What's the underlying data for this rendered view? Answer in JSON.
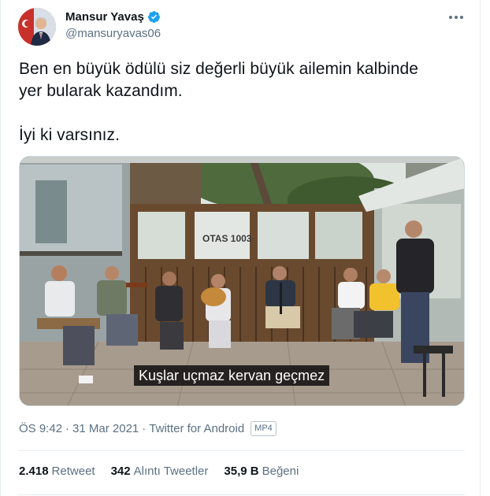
{
  "author": {
    "display_name": "Mansur Yavaş",
    "handle": "@mansuryavas06",
    "verified": true
  },
  "tweet": {
    "text": "Ben en büyük ödülü siz değerli büyük ailemin kalbinde\nyer bularak kazandım.\n\nİyi ki varsınız."
  },
  "media": {
    "caption": "Kuşlar uçmaz kervan geçmez",
    "sign_text": "OTAS 1003"
  },
  "meta": {
    "time": "ÖS 9:42",
    "separator": "·",
    "date": "31 Mar 2021",
    "source": "Twitter for Android",
    "badge": "MP4"
  },
  "stats": {
    "retweets_count": "2.418",
    "retweets_label": "Retweet",
    "quotes_count": "342",
    "quotes_label": "Alıntı Tweetler",
    "likes_count": "35,9 B",
    "likes_label": "Beğeni"
  },
  "colors": {
    "text": "#0f1419",
    "secondary": "#5b7083",
    "verified": "#1da1f2",
    "divider": "#e6ecf0"
  },
  "icons": [
    "verified-badge-icon",
    "more-options-icon"
  ]
}
